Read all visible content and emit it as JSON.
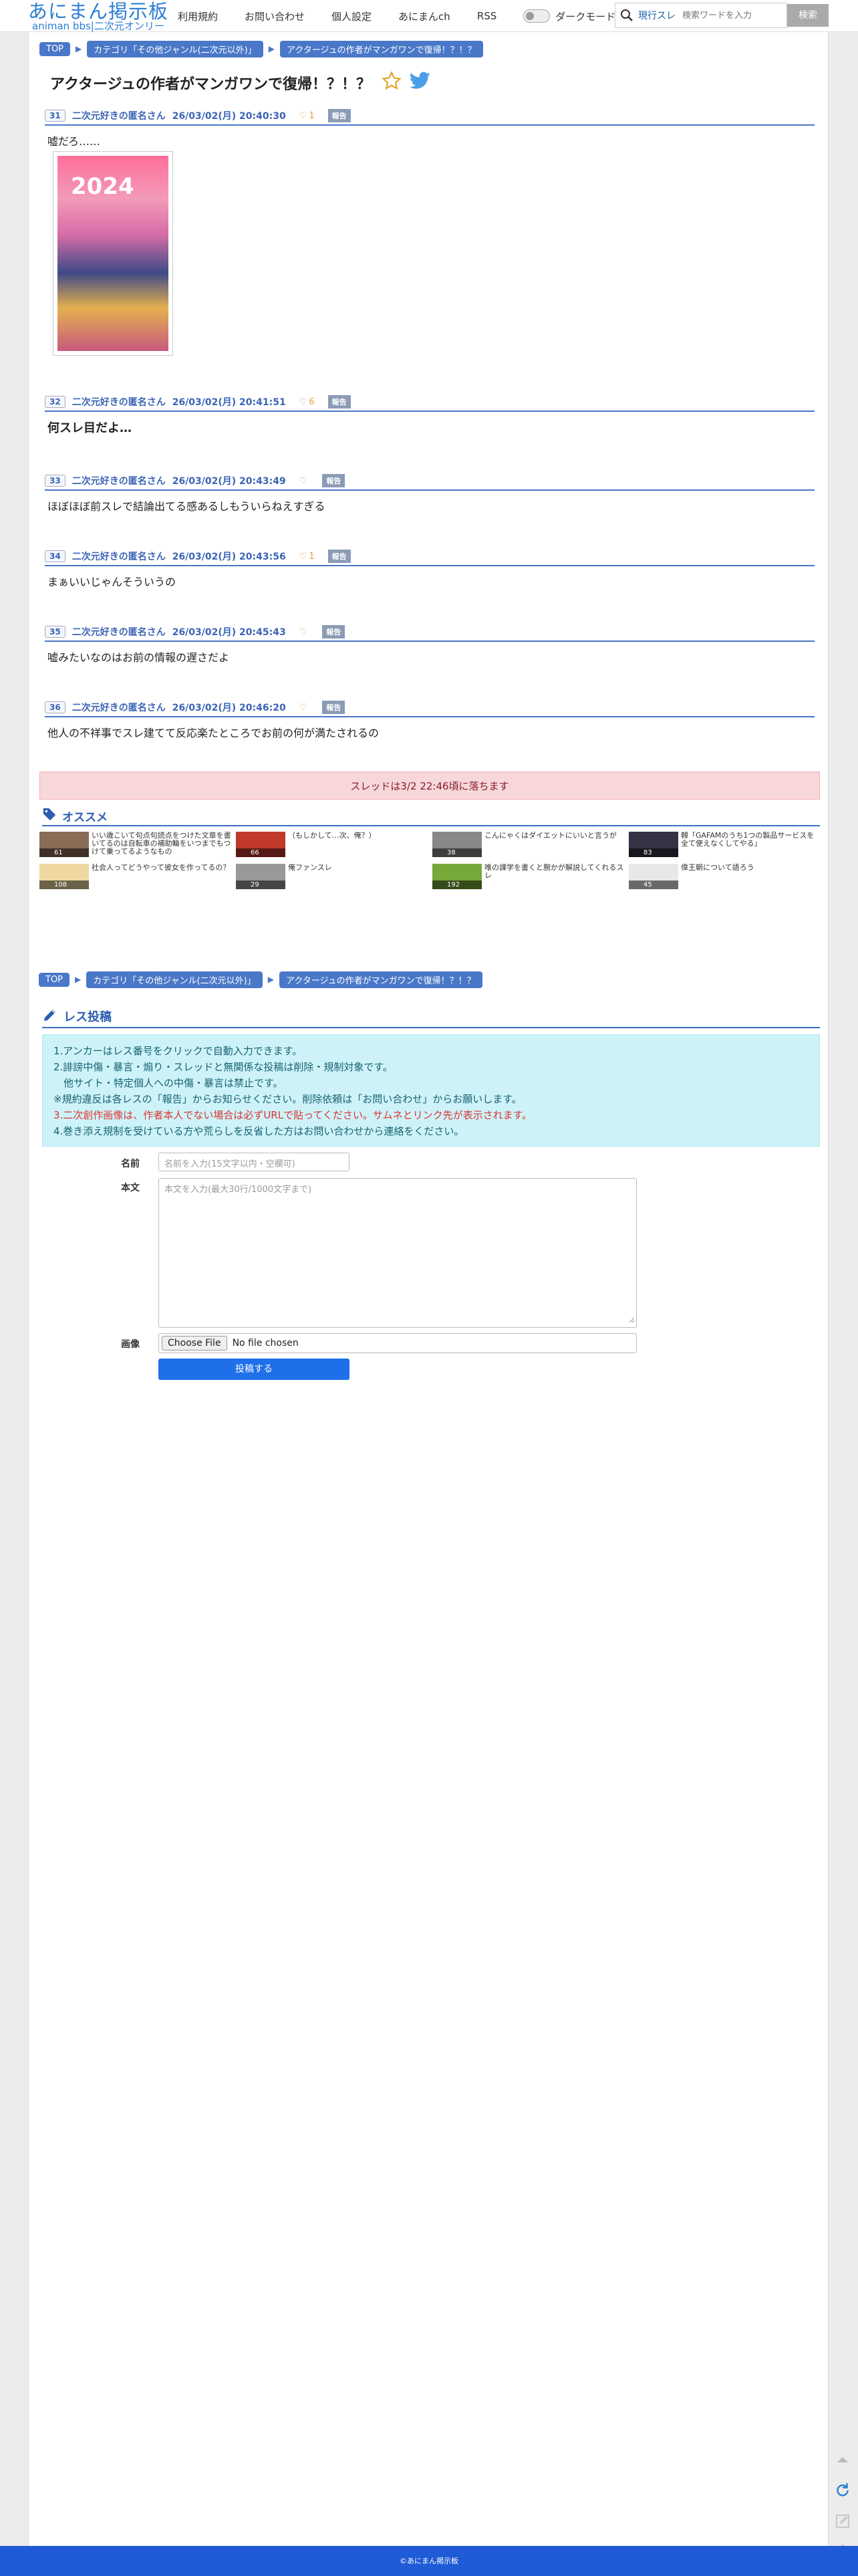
{
  "header": {
    "logo_main": "あにまん掲示板",
    "logo_sub": "animan bbs|二次元オンリー",
    "nav": [
      "利用規約",
      "お問い合わせ",
      "個人設定",
      "あにまんch",
      "RSS"
    ],
    "dark_mode_label": "ダークモード",
    "search_mode": "現行スレ",
    "search_placeholder": "検索ワードを入力",
    "search_button": "検索"
  },
  "breadcrumb": {
    "top": "TOP",
    "category": "カテゴリ「その他ジャンル(二次元以外)」",
    "thread": "アクタージュの作者がマンガワンで復帰！？！？"
  },
  "thread_title": "アクタージュの作者がマンガワンで復帰！？！？",
  "report_label": "報告",
  "posts": [
    {
      "num": "31",
      "author": "二次元好きの匿名さん",
      "date": "26/03/02(月) 20:40:30",
      "likes": "1",
      "body": "嘘だろ……",
      "has_image": true,
      "image_text": "2024"
    },
    {
      "num": "32",
      "author": "二次元好きの匿名さん",
      "date": "26/03/02(月) 20:41:51",
      "likes": "6",
      "body": "何スレ目だよ…"
    },
    {
      "num": "33",
      "author": "二次元好きの匿名さん",
      "date": "26/03/02(月) 20:43:49",
      "likes": "",
      "body": "ほぼほぼ前スレで結論出てる感あるしもういらねえすぎる"
    },
    {
      "num": "34",
      "author": "二次元好きの匿名さん",
      "date": "26/03/02(月) 20:43:56",
      "likes": "1",
      "body": "まぁいいじゃんそういうの"
    },
    {
      "num": "35",
      "author": "二次元好きの匿名さん",
      "date": "26/03/02(月) 20:45:43",
      "likes": "",
      "body": "嘘みたいなのはお前の情報の遅さだよ"
    },
    {
      "num": "36",
      "author": "二次元好きの匿名さん",
      "date": "26/03/02(月) 20:46:20",
      "likes": "",
      "body": "他人の不祥事でスレ建てて反応楽たところでお前の何が満たされるの"
    }
  ],
  "expire_notice": "スレッドは3/2 22:46頃に落ちます",
  "osusume": {
    "heading": "オススメ",
    "items": [
      {
        "count": "61",
        "title": "いい歳こいて句点句読点をつけた文章を書いてるのは自転車の補助輪をいつまでもつけて乗ってるようなもの",
        "color": "#8a6b55"
      },
      {
        "count": "66",
        "title": "（もしかして…次、俺？）",
        "color": "#c0392b"
      },
      {
        "count": "38",
        "title": "こんにゃくはダイエットにいいと言うが",
        "color": "#888888"
      },
      {
        "count": "83",
        "title": "韓「GAFAMのうち1つの製品サービスを全て使えなくしてやる」",
        "color": "#333344"
      },
      {
        "count": "108",
        "title": "社会人ってどうやって彼女を作ってるの？",
        "color": "#f0d9a0"
      },
      {
        "count": "29",
        "title": "俺ファンスレ",
        "color": "#999999"
      },
      {
        "count": "192",
        "title": "唯の課学を書くと腕かが解説してくれるスレ",
        "color": "#76a93a"
      },
      {
        "count": "45",
        "title": "偉王朝について語ろう",
        "color": "#e8e8e8"
      }
    ]
  },
  "post_form": {
    "heading": "レス投稿",
    "notice_lines": [
      "1.アンカーはレス番号をクリックで自動入力できます。",
      "2.誹謗中傷・暴言・煽り・スレッドと無関係な投稿は削除・規制対象です。",
      "　他サイト・特定個人への中傷・暴言は禁止です。",
      "※規約違反は各レスの「報告」からお知らせください。削除依頼は「お問い合わせ」からお願いします。",
      "3.二次創作画像は、作者本人でない場合は必ずURLで貼ってください。サムネとリンク先が表示されます。",
      "4.巻き添え規制を受けている方や荒らしを反省した方はお問い合わせから連絡をください。"
    ],
    "name_label": "名前",
    "name_placeholder": "名前を入力(15文字以内・空欄可)",
    "body_label": "本文",
    "body_placeholder": "本文を入力(最大30行/1000文字まで)",
    "image_label": "画像",
    "file_button": "Choose File",
    "file_text": "No file chosen",
    "submit": "投稿する"
  },
  "footer": "©あにまん掲示板"
}
